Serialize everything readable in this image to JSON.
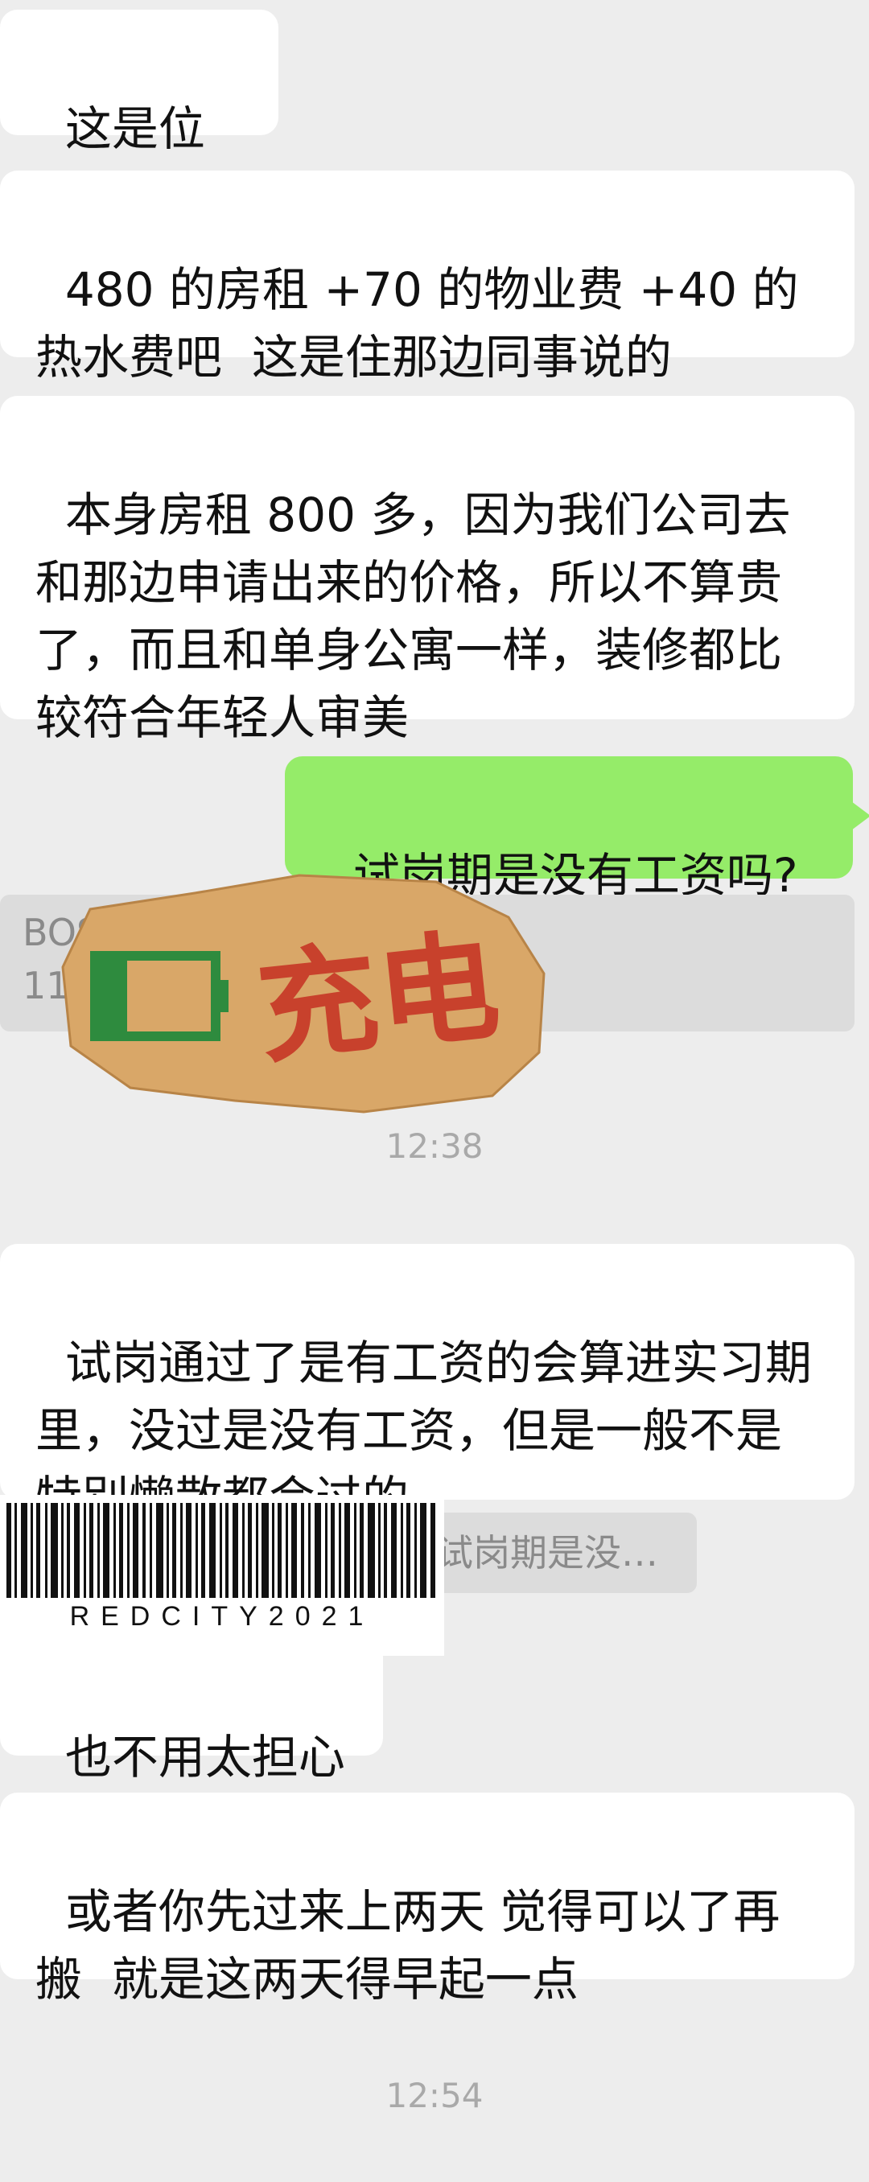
{
  "messages": [
    {
      "text": "这是位置"
    },
    {
      "text": "480 的房租 +70 的物业费 +40 的热水费吧  这是住那边同事说的"
    },
    {
      "text": "本身房租 800 多，因为我们公司去和那边申请出来的价格，所以不算贵了，而且和单身公寓一样，装修都比较符合年轻人审美"
    },
    {
      "text": "试岗期是没有工资吗?"
    },
    {
      "text": "试岗通过了是有工资的会算进实习期里，没过是没有工资，但是一般不是特别懒散都会过的"
    },
    {
      "text": "也不用太担心"
    },
    {
      "text": "或者你先过来上两天 觉得可以了再搬  就是这两天得早起一点"
    }
  ],
  "quotes": [
    {
      "line1": "BOSS直聘（周一上午",
      "line2": "11点…那边是7天试岗…"
    },
    {
      "text": "试岗期是没有工资吗?"
    }
  ],
  "timestamps": [
    "12:38",
    "12:54"
  ],
  "sticker": {
    "text": "充电",
    "icon": "battery-icon"
  },
  "barcode": {
    "text": "REDCITY2021"
  },
  "colors": {
    "background": "#ededed",
    "bubble_in": "#ffffff",
    "bubble_out": "#95ec69",
    "quote": "#dcdcdc",
    "sticker_paper": "#d9a768",
    "sticker_text": "#c8412c",
    "battery": "#2e8b3e"
  }
}
